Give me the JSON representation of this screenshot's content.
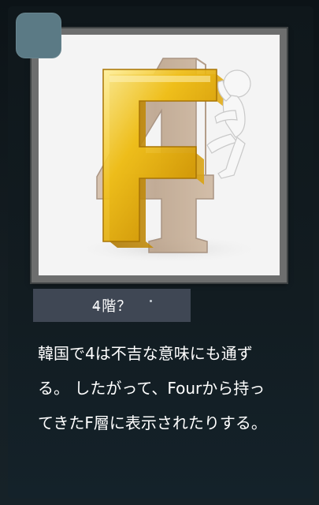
{
  "caption": {
    "text": "4階？"
  },
  "description": {
    "text": "韓国で4は不吉な意味にも通ず\nる。 したがって、Fourから持っ\nてきたF層に表示されたりする。"
  },
  "colors": {
    "background": "#0c1317",
    "badge": "#5b7a85",
    "caption_bg": "#3f4754",
    "letter_gold": "#f2c21b",
    "digit_wood": "#b9a08a",
    "text": "#ffffff"
  },
  "image": {
    "depicts": "gold-letter-F-with-wooden-4-and-climbing-figure"
  }
}
